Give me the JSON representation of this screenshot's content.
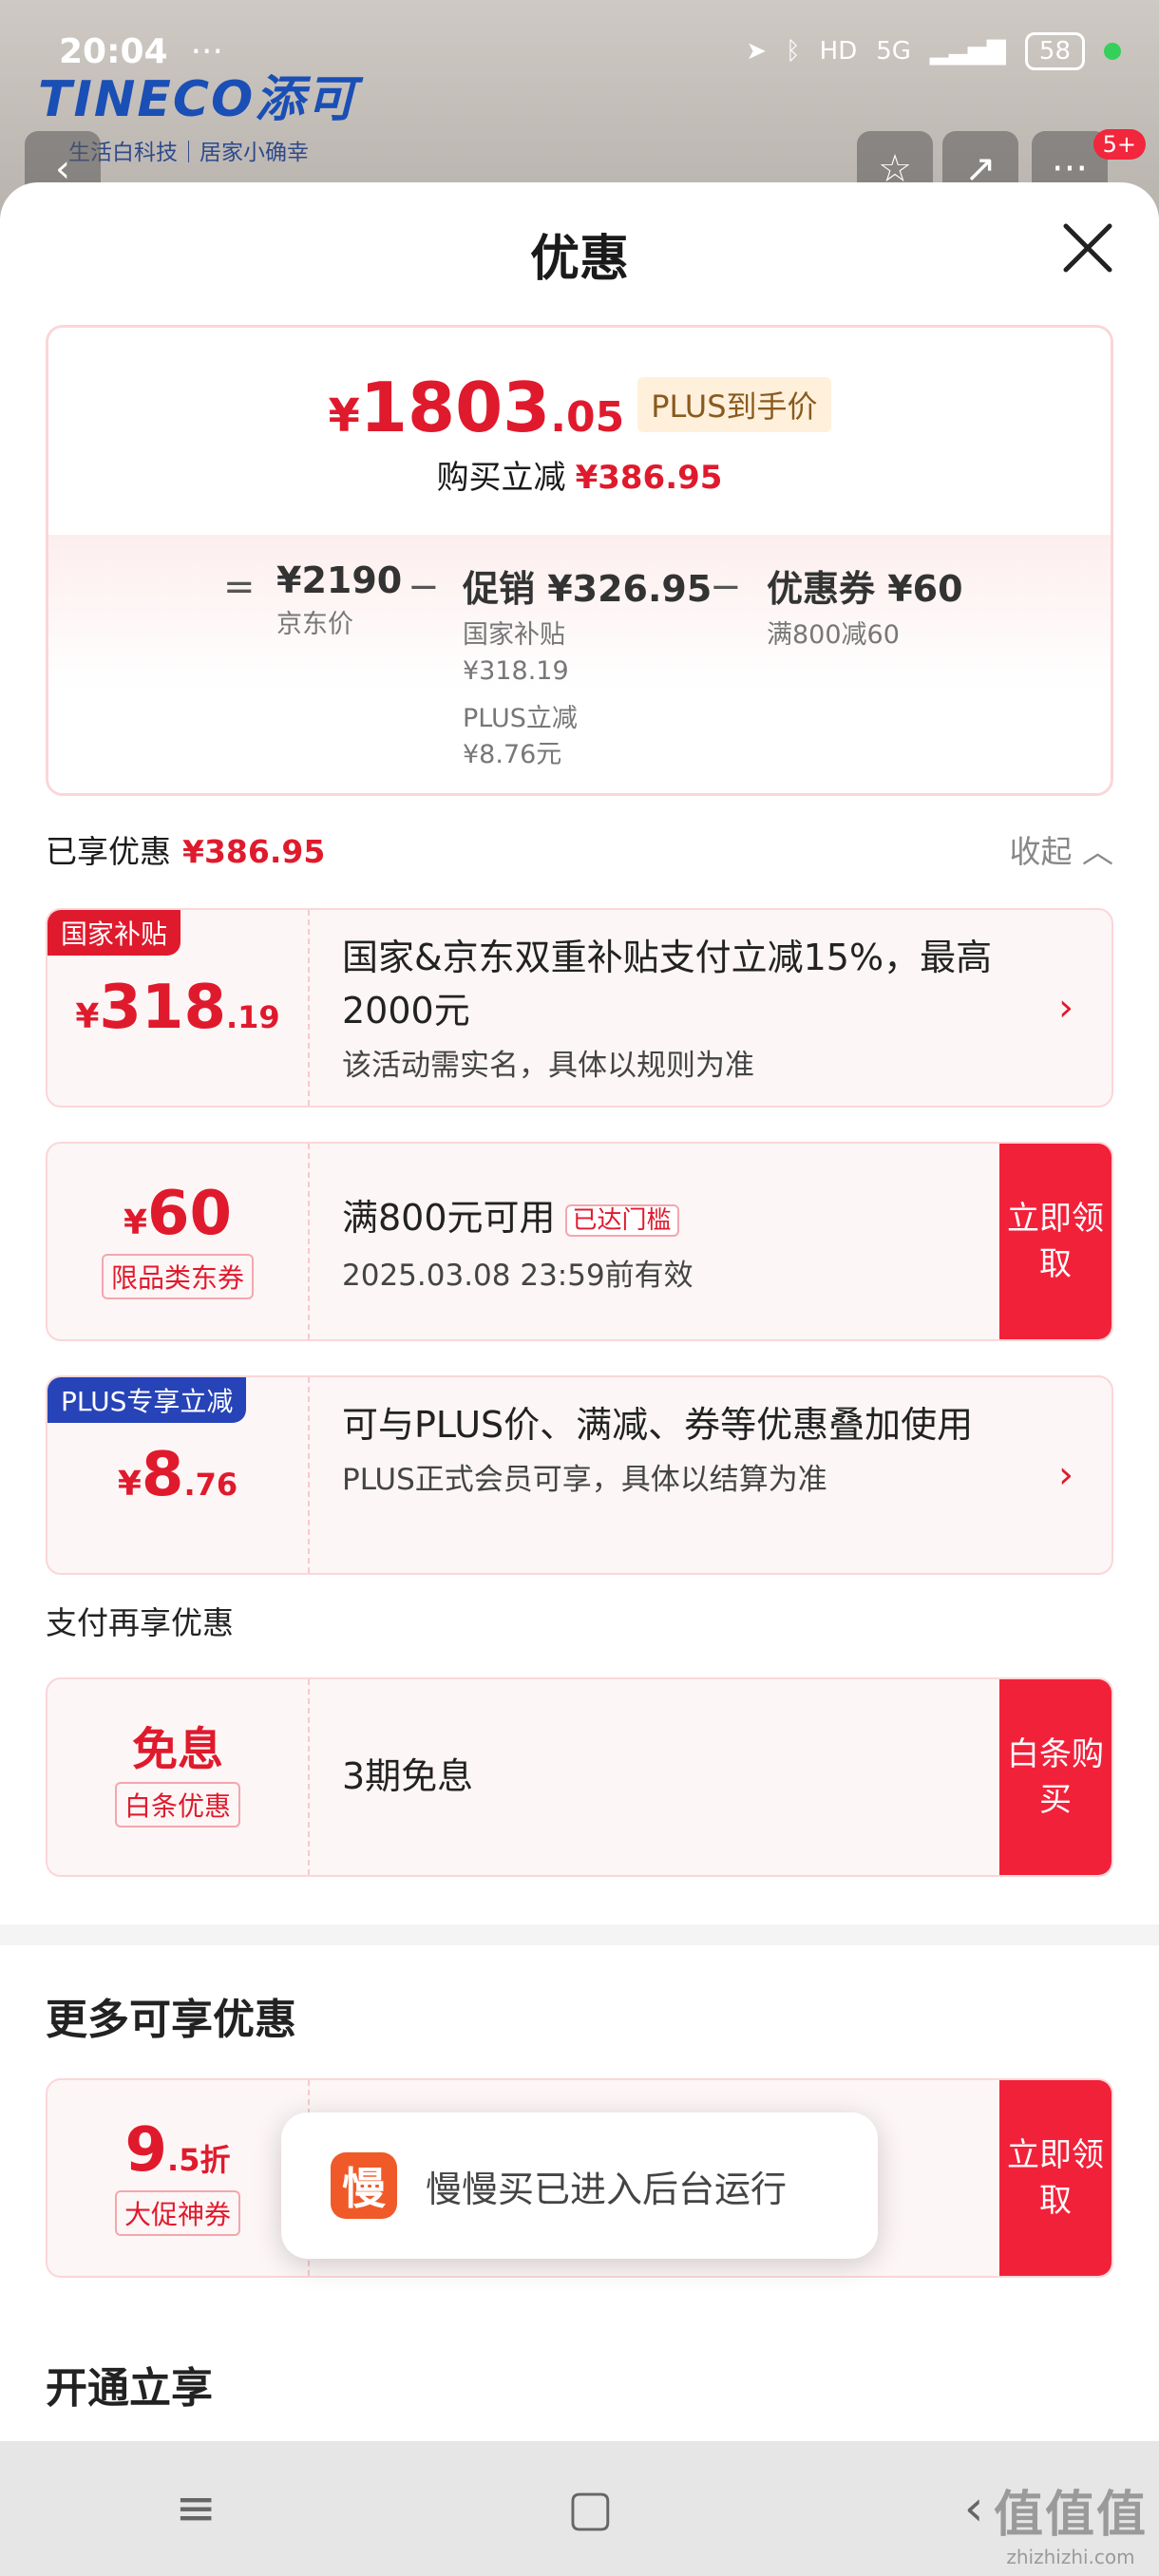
{
  "status_bar": {
    "time": "20:04",
    "more": "···",
    "network": "5G",
    "hd": "HD",
    "battery": "58"
  },
  "brand": {
    "logo": "TINECO添可",
    "slogan": "生活白科技｜居家小确幸",
    "badge": "5+"
  },
  "sheet": {
    "title": "优惠"
  },
  "summary": {
    "yen": "¥",
    "price_int": "1803",
    "price_dec": ".05",
    "plus_label": "PLUS到手价",
    "reduce_label": "购买立减",
    "reduce_amount": "¥386.95",
    "eq": "=",
    "minus": "−",
    "jd_price": "¥2190",
    "jd_price_label": "京东价",
    "promo_value": "促销 ¥326.95",
    "promo_line1": "国家补贴",
    "promo_line2": "¥318.19",
    "promo_line3": "PLUS立减",
    "promo_line4": "¥8.76元",
    "coupon_value": "优惠券 ¥60",
    "coupon_label": "满800减60"
  },
  "enjoyed": {
    "label": "已享优惠",
    "amount": "¥386.95",
    "collapse": "收起 ︿"
  },
  "cards": {
    "subsidy": {
      "tag": "国家补贴",
      "yen": "¥",
      "int": "318",
      "dec": ".19",
      "title": "国家&京东双重补贴支付立减15%，最高2000元",
      "desc": "该活动需实名，具体以规则为准"
    },
    "coupon": {
      "yen": "¥",
      "int": "60",
      "subtag": "限品类东券",
      "title": "满800元可用",
      "met": "已达门槛",
      "desc": "2025.03.08 23:59前有效",
      "btn": "立即领取"
    },
    "plus": {
      "tag": "PLUS专享立减",
      "yen": "¥",
      "int": "8",
      "dec": ".76",
      "title": "可与PLUS价、满减、券等优惠叠加使用",
      "desc": "PLUS正式会员可享，具体以结算为准"
    },
    "baitiao": {
      "main": "免息",
      "subtag": "白条优惠",
      "title": "3期免息",
      "btn": "白条购买"
    },
    "promo": {
      "int": "9",
      "dec": ".5折",
      "subtag": "大促神券",
      "btn": "立即领取"
    }
  },
  "pay_more": "支付再享优惠",
  "more_section": "更多可享优惠",
  "open_section": "开通立享",
  "toast": {
    "icon_char": "慢",
    "message": "慢慢买已进入后台运行"
  },
  "navbar": {
    "menu": "≡",
    "home": "▢",
    "back": "‹"
  },
  "watermark": {
    "main": "值值值",
    "url": "zhizhizhi.com"
  }
}
